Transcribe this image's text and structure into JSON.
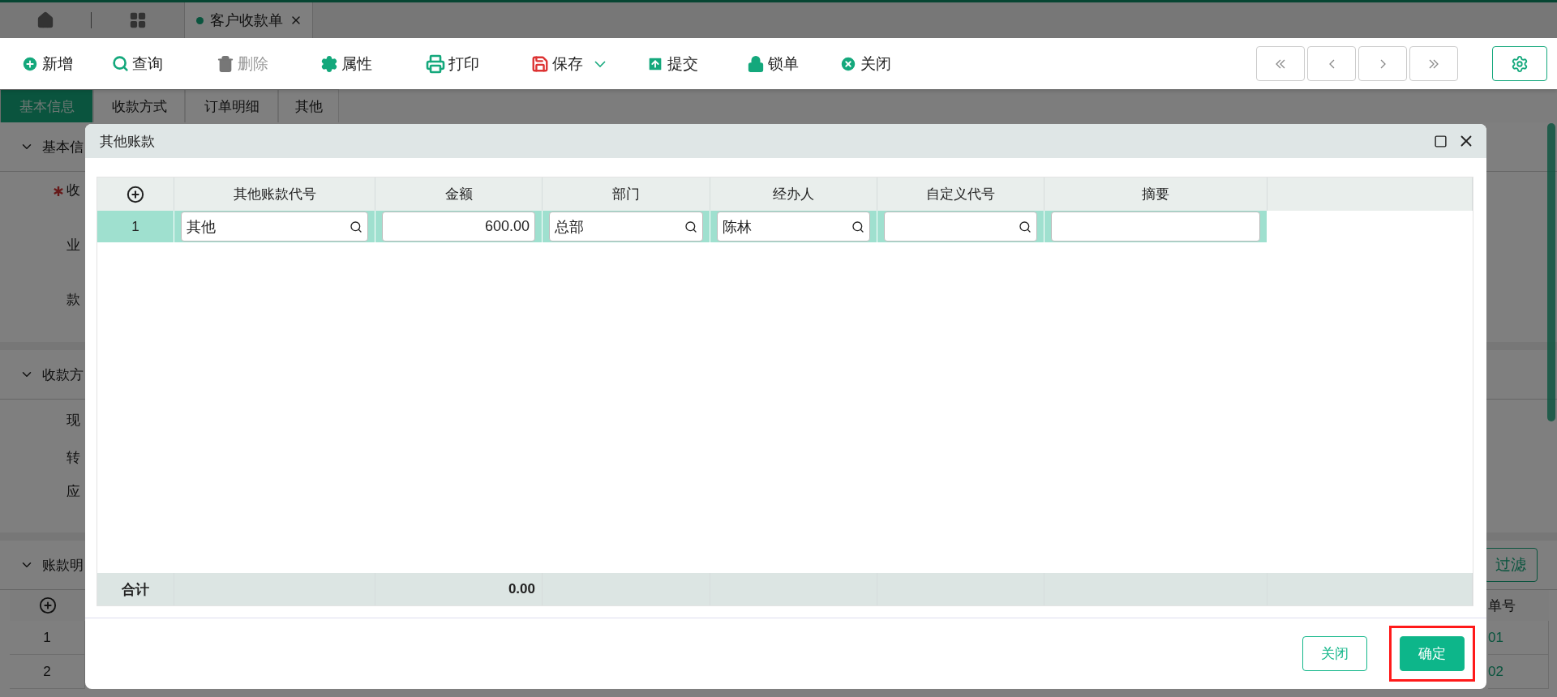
{
  "tab_bar": {
    "tabs": [
      {
        "label": "客户收款单",
        "selected": true
      }
    ]
  },
  "toolbar": {
    "buttons": [
      {
        "label": "新增",
        "disabled": false
      },
      {
        "label": "查询",
        "disabled": false
      },
      {
        "label": "删除",
        "disabled": true
      },
      {
        "label": "属性",
        "disabled": false
      },
      {
        "label": "打印",
        "disabled": false
      },
      {
        "label": "保存",
        "disabled": false,
        "has_menu": true
      },
      {
        "label": "提交",
        "disabled": false
      },
      {
        "label": "锁单",
        "disabled": false
      },
      {
        "label": "关闭",
        "disabled": false
      }
    ]
  },
  "sub_tabs": [
    {
      "label": "基本信息",
      "selected": true
    },
    {
      "label": "收款方式",
      "selected": false
    },
    {
      "label": "订单明细",
      "selected": false
    },
    {
      "label": "其他",
      "selected": false
    }
  ],
  "sections": [
    {
      "title": "基本信",
      "expanded": true,
      "fields": [
        {
          "label": "收",
          "required": true
        },
        {
          "label": "业",
          "required": false
        },
        {
          "label": "款",
          "required": false
        }
      ]
    },
    {
      "title": "收款方",
      "expanded": true,
      "fields": [
        {
          "label": "现",
          "required": false
        },
        {
          "label": "转",
          "required": false
        },
        {
          "label": "应",
          "required": false
        }
      ]
    },
    {
      "title": "账款明",
      "expanded": true,
      "filter_button": "过滤",
      "table": {
        "column_fragment": "单号",
        "rows": [
          {
            "number": "1",
            "fragment": "01"
          },
          {
            "number": "2",
            "fragment": "02"
          }
        ]
      }
    }
  ],
  "dialog": {
    "title": "其他账款",
    "columns": [
      "其他账款代号",
      "金额",
      "部门",
      "经办人",
      "自定义代号",
      "摘要"
    ],
    "rows": [
      {
        "number": "1",
        "selected": true,
        "cells": [
          {
            "kind": "text",
            "value": "其他",
            "lookup": true
          },
          {
            "kind": "number",
            "value": "600.00",
            "lookup": false
          },
          {
            "kind": "text",
            "value": "总部",
            "lookup": true
          },
          {
            "kind": "text",
            "value": "陈林",
            "lookup": true
          },
          {
            "kind": "text",
            "lookup": true
          },
          {
            "kind": "text",
            "lookup": false
          }
        ]
      }
    ],
    "footer": {
      "label": "合计",
      "amount": "0.00"
    },
    "buttons": [
      {
        "label": "关闭",
        "kind": "secondary",
        "highlighted": false
      },
      {
        "label": "确定",
        "kind": "primary",
        "highlighted": true
      }
    ]
  }
}
